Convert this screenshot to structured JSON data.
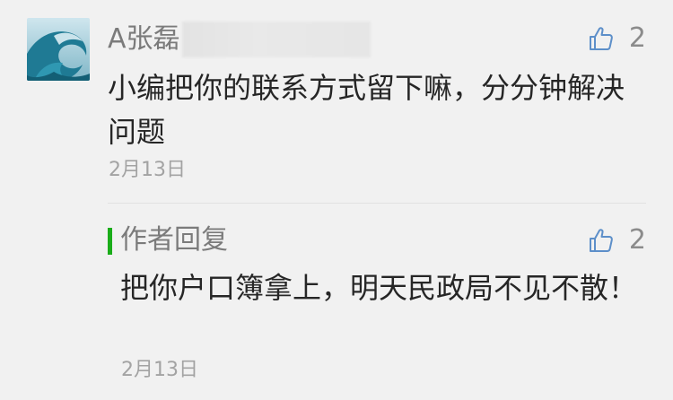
{
  "comment": {
    "user_name": "A张磊",
    "text": "小编把你的联系方式留下嘛，分分钟解决问题",
    "date": "2月13日",
    "like_count": "2",
    "avatar_icon": "wave-avatar",
    "like_icon": "thumbs-up-icon"
  },
  "reply": {
    "title": "作者回复",
    "text": "把你户口簿拿上，明天民政局不见不散！",
    "date": "2月13日",
    "like_count": "2",
    "accent_color": "#1aad19"
  },
  "colors": {
    "background": "#f1f1f1",
    "text": "#262626",
    "meta": "#a3a3a3",
    "name": "#7b7b7b"
  }
}
